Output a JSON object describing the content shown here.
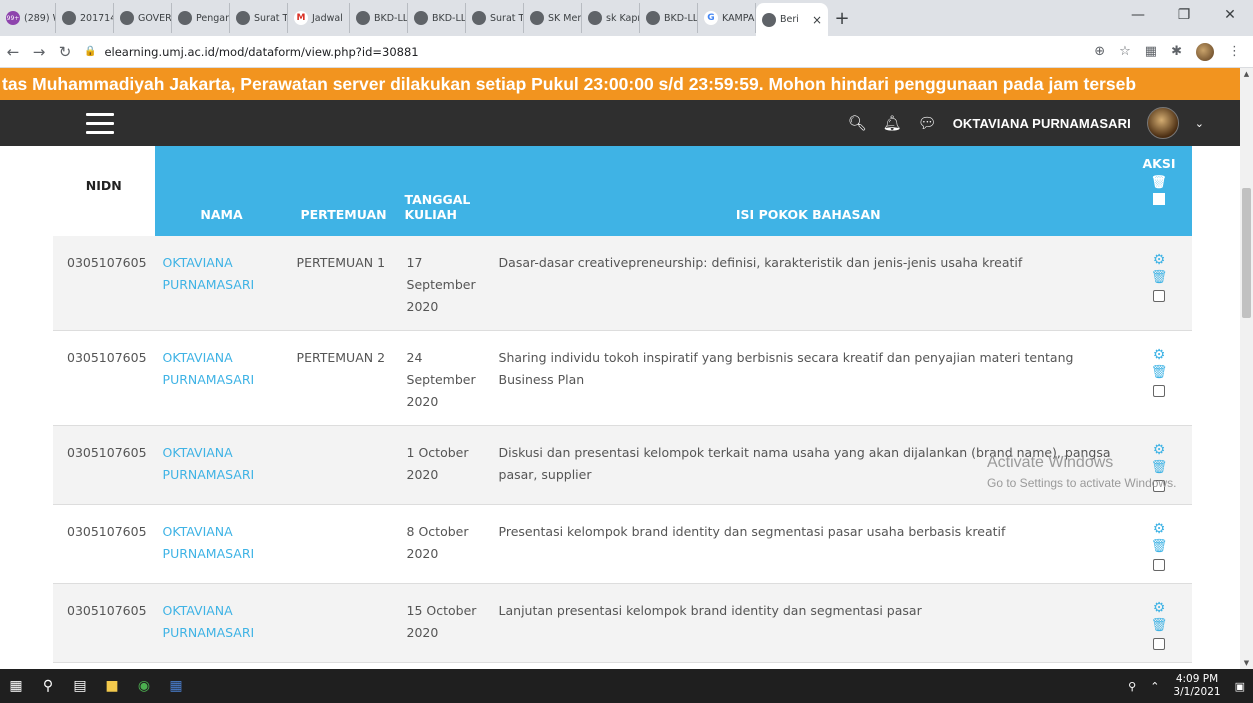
{
  "browser": {
    "tabs": [
      {
        "icon": "99+",
        "label": "(289) W"
      },
      {
        "icon": "globe-icon",
        "label": "201714"
      },
      {
        "icon": "globe-icon",
        "label": "GOVER"
      },
      {
        "icon": "globe-icon",
        "label": "Pengan"
      },
      {
        "icon": "globe-icon",
        "label": "Surat Tu"
      },
      {
        "icon": "M",
        "label": "Jadwal"
      },
      {
        "icon": "globe-icon",
        "label": "BKD-LL"
      },
      {
        "icon": "globe-icon",
        "label": "BKD-LL"
      },
      {
        "icon": "globe-icon",
        "label": "Surat Tu"
      },
      {
        "icon": "globe-icon",
        "label": "SK Men"
      },
      {
        "icon": "globe-icon",
        "label": "sk Kapr"
      },
      {
        "icon": "globe-icon",
        "label": "BKD-LL"
      },
      {
        "icon": "G",
        "label": "KAMPA"
      },
      {
        "icon": "page-icon",
        "label": "Beri",
        "active": true
      }
    ],
    "close_tab": "×",
    "new_tab": "+",
    "url": "elearning.umj.ac.id/mod/dataform/view.php?id=30881"
  },
  "banner": {
    "text": "tas Muhammadiyah Jakarta, Perawatan server dilakukan setiap Pukul 23:00:00 s/d 23:59:59. Mohon hindari penggunaan pada jam terseb"
  },
  "navbar": {
    "username": "OKTAVIANA PURNAMASARI"
  },
  "table": {
    "headers": {
      "nidn": "NIDN",
      "nama": "NAMA",
      "pertemuan": "PERTEMUAN",
      "tanggal": "TANGGAL KULIAH",
      "isi": "ISI POKOK BAHASAN",
      "aksi": "AKSI"
    },
    "rows": [
      {
        "nidn": "0305107605",
        "nama": "OKTAVIANA PURNAMASARI",
        "pertemuan": "PERTEMUAN 1",
        "tanggal": "17 September 2020",
        "isi": "Dasar-dasar creativepreneurship: definisi, karakteristik dan jenis-jenis usaha kreatif"
      },
      {
        "nidn": "0305107605",
        "nama": "OKTAVIANA PURNAMASARI",
        "pertemuan": "PERTEMUAN 2",
        "tanggal": "24 September 2020",
        "isi": "Sharing individu tokoh inspiratif yang berbisnis secara kreatif dan penyajian materi tentang Business Plan"
      },
      {
        "nidn": "0305107605",
        "nama": "OKTAVIANA PURNAMASARI",
        "pertemuan": "",
        "tanggal": "1 October 2020",
        "isi": "Diskusi dan presentasi kelompok terkait nama usaha yang akan dijalankan (brand name), pangsa pasar, supplier"
      },
      {
        "nidn": "0305107605",
        "nama": "OKTAVIANA PURNAMASARI",
        "pertemuan": "",
        "tanggal": "8 October 2020",
        "isi": "Presentasi kelompok brand identity dan segmentasi pasar usaha berbasis kreatif"
      },
      {
        "nidn": "0305107605",
        "nama": "OKTAVIANA PURNAMASARI",
        "pertemuan": "",
        "tanggal": "15 October 2020",
        "isi": "Lanjutan presentasi kelompok brand identity dan segmentasi pasar"
      }
    ]
  },
  "watermark": {
    "line1": "Activate Windows",
    "line2": "Go to Settings to activate Windows."
  },
  "taskbar": {
    "time": "4:09 PM",
    "date": "3/1/2021"
  },
  "colors": {
    "accent": "#3fb3e5",
    "banner": "#f2941f",
    "navbar": "#2f2f2f"
  }
}
